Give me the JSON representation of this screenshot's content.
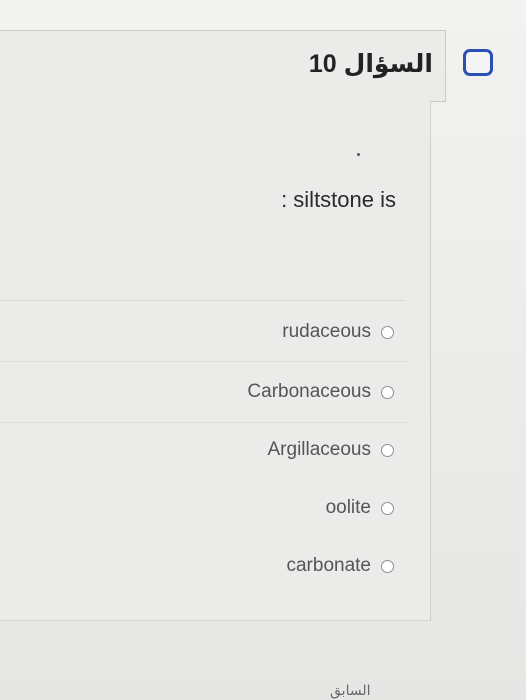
{
  "question": {
    "title": "السؤال 10",
    "text": ": siltstone is"
  },
  "options": [
    {
      "label": "rudaceous"
    },
    {
      "label": "Carbonaceous"
    },
    {
      "label": "Argillaceous"
    },
    {
      "label": "oolite"
    },
    {
      "label": "carbonate"
    }
  ],
  "footer": {
    "label": "السابق"
  },
  "icons": {
    "flag": "flag-outline-icon",
    "radio": "radio-empty-icon"
  },
  "colors": {
    "accent": "#2b4fb3"
  }
}
